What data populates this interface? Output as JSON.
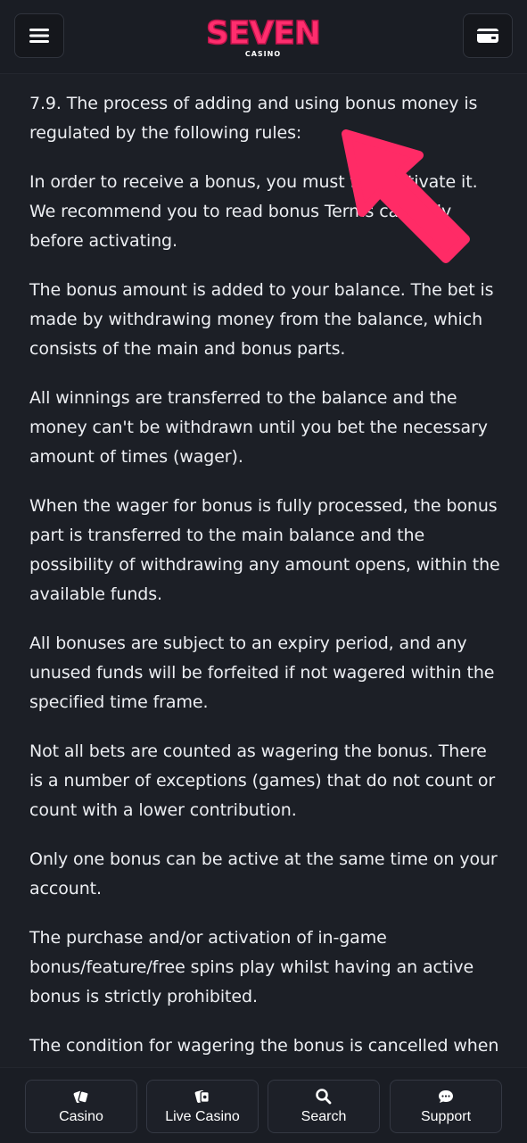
{
  "header": {
    "logo_text": "SEVEN",
    "logo_subtext": "CASINO",
    "brand_color": "#ff2e6e"
  },
  "content": {
    "paragraphs": [
      "7.9. The process of adding and using bonus money is regulated by the following rules:",
      "In order to receive a bonus, you must first activate it. We recommend you to read bonus Terms carefully before activating.",
      "The bonus amount is added to your balance. The bet is made by withdrawing money from the balance, which consists of the main and bonus parts.",
      "All winnings are transferred to the balance and the money can't be withdrawn until you bet the necessary amount of times (wager).",
      "When the wager for bonus is fully processed, the bonus part is transferred to the main balance and the possibility of withdrawing any amount opens, within the available funds.",
      "All bonuses are subject to an expiry period, and any unused funds will be forfeited if not wagered within the specified time frame.",
      "Not all bets are counted as wagering the bonus. There is a number of exceptions (games) that do not count or count with a lower contribution.",
      "Only one bonus can be active at the same time on your account.",
      "The purchase and/or activation of in-game bonus/feature/free spins play whilst having an active bonus is strictly prohibited.",
      "The condition for wagering the bonus is cancelled when"
    ]
  },
  "annotation": {
    "arrow_color": "#ff2b66",
    "arrow_icon": "arrow-up-left-icon"
  },
  "bottom_nav": {
    "items": [
      {
        "label": "Casino",
        "icon": "cards-icon"
      },
      {
        "label": "Live Casino",
        "icon": "live-cards-icon"
      },
      {
        "label": "Search",
        "icon": "search-icon"
      },
      {
        "label": "Support",
        "icon": "chat-icon"
      }
    ]
  }
}
